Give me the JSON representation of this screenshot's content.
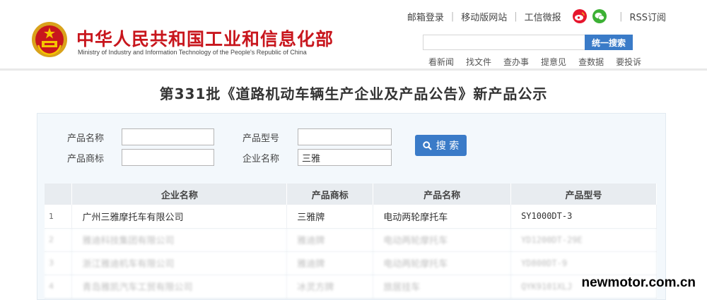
{
  "header": {
    "title": "中华人民共和国工业和信息化部",
    "subtitle": "Ministry of Industry and Information Technology of the People's Republic of China",
    "emblem_icon": "national-emblem-icon",
    "top_links": [
      "邮箱登录",
      "移动版网站",
      "工信微报",
      "RSS订阅"
    ],
    "social_icons": [
      "weibo-icon",
      "wechat-icon"
    ],
    "search": {
      "placeholder": "",
      "button": "统一搜索"
    },
    "quick_links": [
      "看新闻",
      "找文件",
      "查办事",
      "提意见",
      "查数据",
      "要投诉"
    ]
  },
  "page_title": "第331批《道路机动车辆生产企业及产品公告》新产品公示",
  "form": {
    "product_name": {
      "label": "产品名称",
      "value": ""
    },
    "product_model": {
      "label": "产品型号",
      "value": ""
    },
    "product_brand": {
      "label": "产品商标",
      "value": ""
    },
    "company_name": {
      "label": "企业名称",
      "value": "三雅"
    },
    "search_button": "搜 索",
    "search_icon": "search-icon"
  },
  "table": {
    "headers": [
      "",
      "企业名称",
      "产品商标",
      "产品名称",
      "产品型号"
    ],
    "rows": [
      {
        "index": "1",
        "company": "广州三雅摩托车有限公司",
        "brand": "三雅牌",
        "product": "电动两轮摩托车",
        "model": "SY1000DT-3"
      },
      {
        "index": "2",
        "company": "雅迪科技集团有限公司",
        "brand": "雅迪牌",
        "product": "电动两轮摩托车",
        "model": "YD1200DT-29E"
      },
      {
        "index": "3",
        "company": "浙江雅迪机车有限公司",
        "brand": "雅迪牌",
        "product": "电动两轮摩托车",
        "model": "YD800DT-9"
      },
      {
        "index": "4",
        "company": "青岛雅凯汽车工贸有限公司",
        "brand": "冰灵方牌",
        "product": "旅居挂车",
        "model": "QYK9101XLJ"
      }
    ]
  },
  "watermark": "newmotor.com.cn",
  "colors": {
    "brand_red": "#c8161d",
    "accent_blue": "#3a7bc8",
    "panel_bg": "#f3f8fc",
    "header_row": "#e8ecf0"
  }
}
